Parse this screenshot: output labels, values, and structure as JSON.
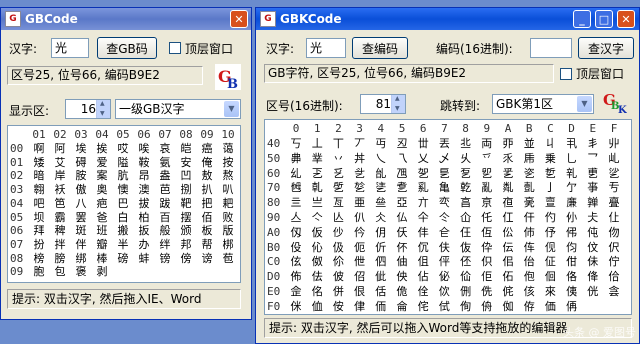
{
  "gb": {
    "title": "GBCode",
    "hanzi_label": "汉字:",
    "hanzi_value": "光",
    "lookup_button": "查GB码",
    "ontop_label": "顶层窗口",
    "info": "区号25, 位号66, 编码B9E2",
    "zone_label": "显示区:",
    "zone_value": "16",
    "level_value": "一级GB汉字",
    "col_header": [
      "01",
      "02",
      "03",
      "04",
      "05",
      "06",
      "07",
      "08",
      "09",
      "10"
    ],
    "rows": [
      {
        "label": "00",
        "chars": [
          "啊",
          "阿",
          "埃",
          "挨",
          "哎",
          "唉",
          "哀",
          "皑",
          "癌",
          "蔼"
        ]
      },
      {
        "label": "01",
        "chars": [
          "矮",
          "艾",
          "碍",
          "爱",
          "隘",
          "鞍",
          "氨",
          "安",
          "俺",
          "按"
        ]
      },
      {
        "label": "02",
        "chars": [
          "暗",
          "岸",
          "胺",
          "案",
          "肮",
          "昂",
          "盎",
          "凹",
          "敖",
          "熬"
        ]
      },
      {
        "label": "03",
        "chars": [
          "翱",
          "袄",
          "傲",
          "奥",
          "懊",
          "澳",
          "芭",
          "捌",
          "扒",
          "叭"
        ]
      },
      {
        "label": "04",
        "chars": [
          "吧",
          "笆",
          "八",
          "疤",
          "巴",
          "拔",
          "跋",
          "靶",
          "把",
          "耙"
        ]
      },
      {
        "label": "05",
        "chars": [
          "坝",
          "霸",
          "罢",
          "爸",
          "白",
          "柏",
          "百",
          "摆",
          "佰",
          "败"
        ]
      },
      {
        "label": "06",
        "chars": [
          "拜",
          "稗",
          "斑",
          "班",
          "搬",
          "扳",
          "般",
          "颁",
          "板",
          "版"
        ]
      },
      {
        "label": "07",
        "chars": [
          "扮",
          "拌",
          "伴",
          "瓣",
          "半",
          "办",
          "绊",
          "邦",
          "帮",
          "梆"
        ]
      },
      {
        "label": "08",
        "chars": [
          "榜",
          "膀",
          "绑",
          "棒",
          "磅",
          "蚌",
          "镑",
          "傍",
          "谤",
          "苞"
        ]
      },
      {
        "label": "09",
        "chars": [
          "胞",
          "包",
          "褒",
          "剥",
          "",
          "",
          "",
          "",
          "",
          ""
        ]
      }
    ],
    "status": "提示: 双击汉字, 然后拖入IE、Word"
  },
  "gbk": {
    "title": "GBKCode",
    "hanzi_label": "汉字:",
    "hanzi_value": "光",
    "lookup_button": "查编码",
    "hex_label": "编码(16进制):",
    "hex_value": "",
    "lookup_hanzi_button": "查汉字",
    "info": "GB字符, 区号25, 位号66, 编码B9E2",
    "ontop_label": "顶层窗口",
    "zone_label": "区号(16进制):",
    "zone_value": "81",
    "jump_label": "跳转到:",
    "jump_value": "GBK第1区",
    "col_header": [
      "0",
      "1",
      "2",
      "3",
      "4",
      "5",
      "6",
      "7",
      "8",
      "9",
      "A",
      "B",
      "C",
      "D",
      "E",
      "F"
    ],
    "rows": [
      {
        "label": "40",
        "chars": [
          "丂",
          "丄",
          "丅",
          "丆",
          "丏",
          "丒",
          "丗",
          "丟",
          "丠",
          "両",
          "丣",
          "並",
          "丩",
          "丮",
          "丯",
          "丱"
        ]
      },
      {
        "label": "50",
        "chars": [
          "丳",
          "丵",
          "丷",
          "丼",
          "乀",
          "乁",
          "乂",
          "乄",
          "乆",
          "乊",
          "乑",
          "乕",
          "乗",
          "乚",
          "乛",
          "乢"
        ]
      },
      {
        "label": "60",
        "chars": [
          "乣",
          "乤",
          "乥",
          "乧",
          "乨",
          "乪",
          "乫",
          "乬",
          "乭",
          "乮",
          "乯",
          "乲",
          "乴",
          "乵",
          "乶",
          "乷"
        ]
      },
      {
        "label": "70",
        "chars": [
          "乸",
          "乹",
          "乺",
          "乻",
          "乼",
          "乽",
          "乿",
          "亀",
          "亁",
          "亂",
          "亃",
          "亄",
          "亅",
          "亇",
          "亊",
          "亐"
        ]
      },
      {
        "label": "80",
        "chars": [
          "亖",
          "亗",
          "亙",
          "亜",
          "亝",
          "亞",
          "亣",
          "亪",
          "亯",
          "亰",
          "亱",
          "亴",
          "亶",
          "亷",
          "亸",
          "亹"
        ]
      },
      {
        "label": "90",
        "chars": [
          "亼",
          "亽",
          "亾",
          "仈",
          "仌",
          "仏",
          "仐",
          "仒",
          "仚",
          "仛",
          "仜",
          "仠",
          "仢",
          "仦",
          "仧",
          "仩"
        ]
      },
      {
        "label": "A0",
        "chars": [
          "仭",
          "仮",
          "仯",
          "仱",
          "仴",
          "仸",
          "仹",
          "仺",
          "仼",
          "仾",
          "伀",
          "伂",
          "伃",
          "伄",
          "伅",
          "伆"
        ]
      },
      {
        "label": "B0",
        "chars": [
          "伇",
          "伈",
          "伋",
          "伌",
          "伒",
          "伓",
          "伔",
          "伕",
          "伖",
          "伜",
          "伝",
          "伡",
          "伣",
          "伨",
          "伩",
          "伬"
        ]
      },
      {
        "label": "C0",
        "chars": [
          "伭",
          "伮",
          "伱",
          "伳",
          "伵",
          "伷",
          "伹",
          "伻",
          "伾",
          "伿",
          "佀",
          "佁",
          "佂",
          "佄",
          "佅",
          "佇"
        ]
      },
      {
        "label": "D0",
        "chars": [
          "佈",
          "佉",
          "佊",
          "佋",
          "佌",
          "佒",
          "佔",
          "佖",
          "佡",
          "佢",
          "佦",
          "佨",
          "佪",
          "佫",
          "佭",
          "佮"
        ]
      },
      {
        "label": "E0",
        "chars": [
          "佱",
          "佲",
          "併",
          "佷",
          "佸",
          "佹",
          "佺",
          "佽",
          "侀",
          "侁",
          "侂",
          "侅",
          "來",
          "侇",
          "侊",
          "侌"
        ]
      },
      {
        "label": "F0",
        "chars": [
          "侎",
          "侐",
          "侒",
          "侓",
          "侕",
          "侖",
          "侘",
          "侙",
          "侚",
          "侜",
          "侞",
          "侟",
          "価",
          "侢",
          "",
          ""
        ]
      }
    ],
    "status": "提示: 双击汉字, 然后可以拖入Word等支持拖放的编辑器"
  },
  "watermark": "头条 @ 爱图号"
}
